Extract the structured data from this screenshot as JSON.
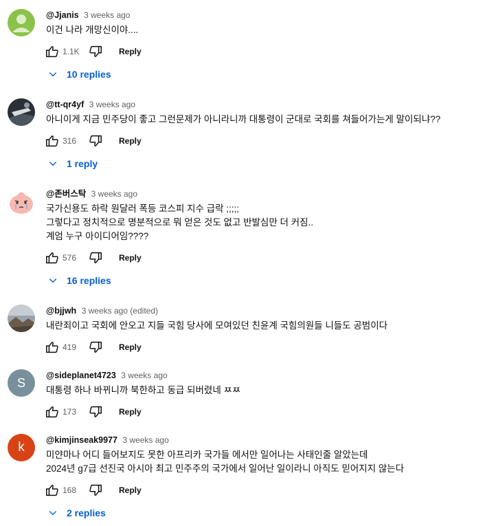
{
  "comments": [
    {
      "author": "@Jjanis",
      "time": "3 weeks ago",
      "text": "이건 나라 개망신이야....",
      "likes": "1.1K",
      "reply_label": "Reply",
      "replies_label": "10 replies",
      "avatar": "default-person-green"
    },
    {
      "author": "@tt-qr4yf",
      "time": "3 weeks ago",
      "text": "아니이게 지금 민주당이 좋고 그런문제가 아니라니까 대통령이 군대로 국회를 쳐들어가는게 말이되냐??",
      "likes": "316",
      "reply_label": "Reply",
      "replies_label": "1 reply",
      "avatar": "dark-photo"
    },
    {
      "author": "@존버스탁",
      "time": "3 weeks ago",
      "text": "국가신용도 하락 원달러 폭등 코스피 지수 급락 ;;;;;\n그렇다고 정치적으로 명분적으로 뭐 얻은 것도 없고 반발심만 더 커짐..\n계엄 누구 아이디어임????",
      "likes": "576",
      "reply_label": "Reply",
      "replies_label": "16 replies",
      "avatar": "pink-character"
    },
    {
      "author": "@bjjwh",
      "time": "3 weeks ago (edited)",
      "text": "내란죄이고 국회에 안오고 지들 국힘 당사에 모여있던 친윤계 국힘의원들 니들도 공범이다",
      "likes": "419",
      "reply_label": "Reply",
      "avatar": "landscape-photo"
    },
    {
      "author": "@sideplanet4723",
      "time": "3 weeks ago",
      "text": "대통령 하나 바뀌니까 북한하고 동급 되버렸네 ㅉㅉ",
      "likes": "173",
      "reply_label": "Reply",
      "avatar_letter": "S",
      "avatar_color": "#78909c"
    },
    {
      "author": "@kimjinseak9977",
      "time": "3 weeks ago",
      "text": "미얀마나 어디 들어보지도 못한 아프리카 국가들 에서만 일어나는 사태인줄 알았는데\n2024년 g7급 선진국 아시아 최고 민주주의 국가에서 일어난 일이라니 아직도 믿어지지 않는다",
      "likes": "168",
      "reply_label": "Reply",
      "replies_label": "2 replies",
      "avatar_letter": "k",
      "avatar_color": "#d84315"
    }
  ],
  "colors": {
    "link": "#065fd4",
    "muted": "#606060"
  }
}
